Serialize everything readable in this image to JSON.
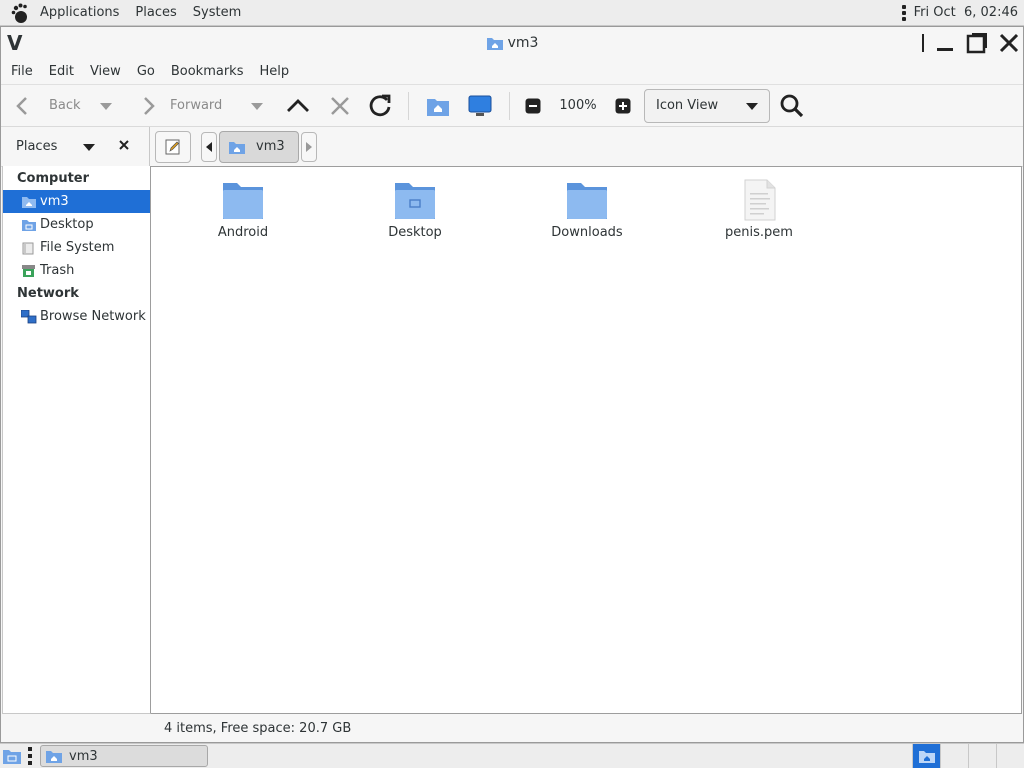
{
  "top_panel": {
    "menus": [
      "Applications",
      "Places",
      "System"
    ],
    "clock": "Fri Oct  6, 02:46"
  },
  "window": {
    "wm_logo": "V",
    "title": "vm3",
    "menubar": [
      "File",
      "Edit",
      "View",
      "Go",
      "Bookmarks",
      "Help"
    ]
  },
  "toolbar": {
    "back_label": "Back",
    "forward_label": "Forward",
    "zoom_level": "100%",
    "view_mode": "Icon View"
  },
  "location": {
    "sidebar_title": "Places",
    "crumbs": [
      "vm3"
    ]
  },
  "sidebar": {
    "sections": [
      {
        "title": "Computer",
        "items": [
          "vm3",
          "Desktop",
          "File System",
          "Trash"
        ]
      },
      {
        "title": "Network",
        "items": [
          "Browse Network"
        ]
      }
    ],
    "selected": "vm3"
  },
  "files": [
    {
      "name": "Android",
      "kind": "folder"
    },
    {
      "name": "Desktop",
      "kind": "desktop-folder"
    },
    {
      "name": "Downloads",
      "kind": "folder"
    },
    {
      "name": "penis.pem",
      "kind": "text-file"
    }
  ],
  "status": "4 items, Free space: 20.7 GB",
  "taskbar": {
    "task_label": "vm3"
  },
  "colors": {
    "selection": "#1f6fd6",
    "folder": "#6fa3e6"
  }
}
